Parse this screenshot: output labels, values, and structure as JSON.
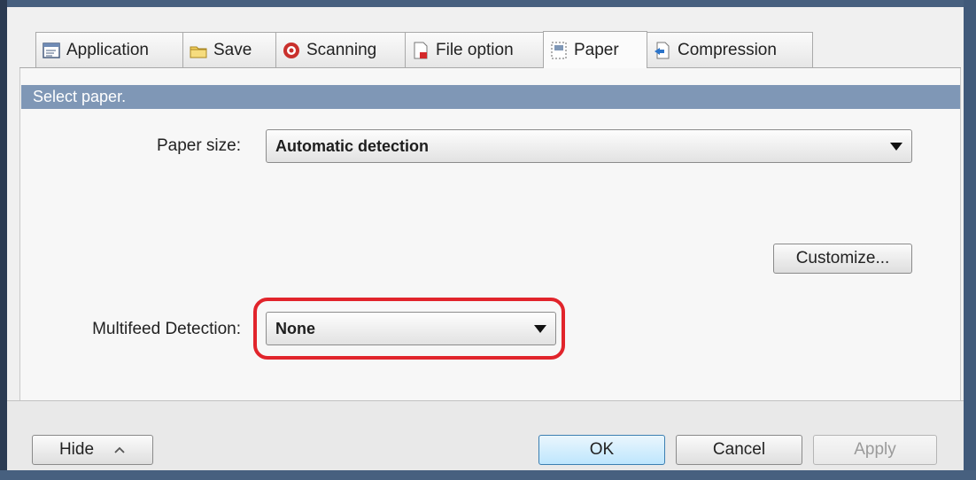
{
  "tabs": [
    {
      "label": "Application",
      "icon": "application-icon"
    },
    {
      "label": "Save",
      "icon": "folder-icon"
    },
    {
      "label": "Scanning",
      "icon": "scanning-icon"
    },
    {
      "label": "File option",
      "icon": "file-option-icon"
    },
    {
      "label": "Paper",
      "icon": "paper-icon",
      "active": true
    },
    {
      "label": "Compression",
      "icon": "compression-icon"
    }
  ],
  "header": {
    "text": "Select paper."
  },
  "paper_size": {
    "label": "Paper size:",
    "value": "Automatic detection"
  },
  "customize_label": "Customize...",
  "multifeed": {
    "label": "Multifeed Detection:",
    "value": "None"
  },
  "footer": {
    "hide_label": "Hide",
    "ok_label": "OK",
    "cancel_label": "Cancel",
    "apply_label": "Apply"
  },
  "colors": {
    "header_band": "#7f97b6",
    "highlight": "#e1242b"
  }
}
